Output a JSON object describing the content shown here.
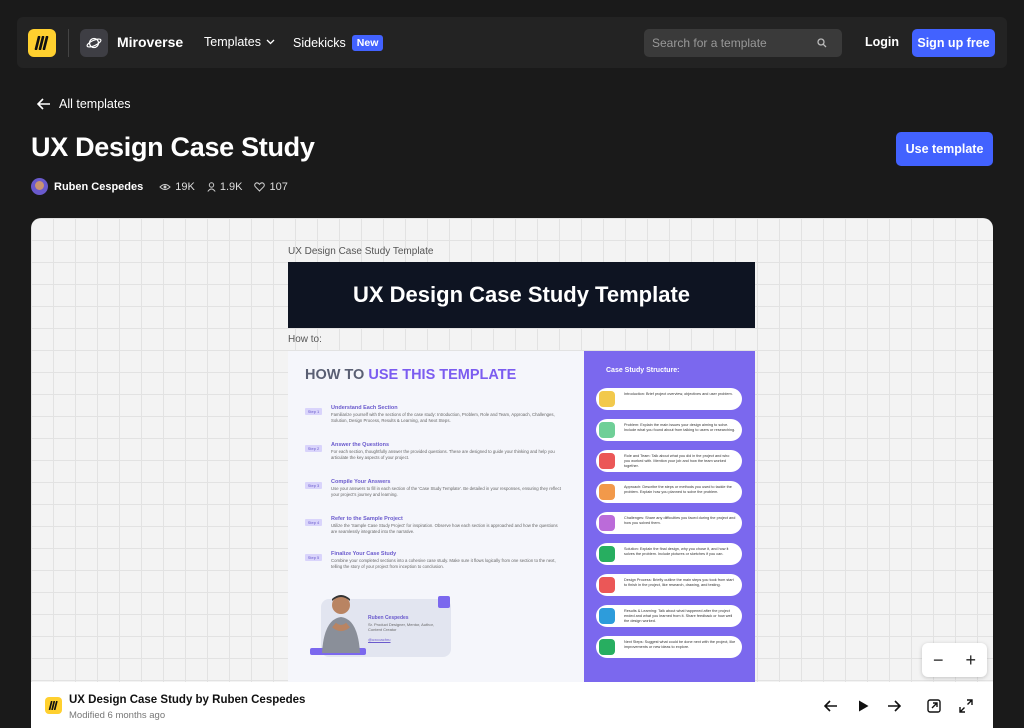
{
  "nav": {
    "brand": "Miroverse",
    "templates_label": "Templates",
    "sidekicks_label": "Sidekicks",
    "new_badge": "New",
    "search_placeholder": "Search for a template",
    "login_label": "Login",
    "signup_label": "Sign up free"
  },
  "header": {
    "back_label": "All templates",
    "title": "UX Design Case Study",
    "use_template_label": "Use template",
    "author": "Ruben Cespedes",
    "views": "19K",
    "users": "1.9K",
    "likes": "107"
  },
  "board": {
    "frame_label": "UX Design Case Study Template",
    "banner_title": "UX Design Case Study Template",
    "howto_label": "How to:",
    "how_title_a": "HOW TO ",
    "how_title_b": "USE THIS TEMPLATE",
    "steps": [
      {
        "tag": "Step 1",
        "heading": "Understand Each Section",
        "text": "Familiarize yourself with the sections of the case study: Introduction, Problem, Role and Team, Approach, Challenges, Solution, Design Process, Results & Learning, and Next Steps."
      },
      {
        "tag": "Step 2",
        "heading": "Answer the Questions",
        "text": "For each section, thoughtfully answer the provided questions. These are designed to guide your thinking and help you articulate the key aspects of your project."
      },
      {
        "tag": "Step 3",
        "heading": "Compile Your Answers",
        "text": "Use your answers to fill in each section of the 'Case Study Template'. Be detailed in your responses, ensuring they reflect your project's journey and learning."
      },
      {
        "tag": "Step 4",
        "heading": "Refer to the Sample Project",
        "text": "Utilize the 'Sample Case Study Project' for inspiration. Observe how each section is approached and how the questions are seamlessly integrated into the narrative."
      },
      {
        "tag": "Step 5",
        "heading": "Finalize Your Case Study",
        "text": "Combine your completed sections into a cohesive case study. Make sure it flows logically from one section to the next, telling the story of your project from inception to conclusion."
      }
    ],
    "person_name": "Ruben Cespedes",
    "person_role": "Sr. Product Designer, Mentor, Author, Content Creator",
    "person_link": "@uxcoachru",
    "structure_title": "Case Study Structure:",
    "structure_items": [
      {
        "text": "Introduction: Brief project overview, objectives and user problem.",
        "color": "#f2c94c"
      },
      {
        "text": "Problem: Explain the main issues your design aiming to solve. Include what you found about from talking to users or researching.",
        "color": "#6fcf97"
      },
      {
        "text": "Role and Team: Talk about what you did in the project and who you worked with. Mention your job and how the team worked together.",
        "color": "#eb5757"
      },
      {
        "text": "Approach: Describe the steps or methods you used to tackle the problem. Explain how you planned to solve the problem.",
        "color": "#f2994a"
      },
      {
        "text": "Challenges: Share any difficulties you faced during the project and how you solved them.",
        "color": "#bb6bd9"
      },
      {
        "text": "Solution: Explain the final design, why you chose it, and how it solves the problem. Include pictures or sketches if you can.",
        "color": "#27ae60"
      },
      {
        "text": "Design Process: Briefly outline the main steps you took from start to finish in the project, like research, drawing, and testing.",
        "color": "#eb5757"
      },
      {
        "text": "Results & Learning: Talk about what happened after the project ended and what you learned from it. Share feedback or how well the design worked.",
        "color": "#2d9cdb"
      },
      {
        "text": "Next Steps: Suggest what could be done next with the project, like improvements or new ideas to explore.",
        "color": "#27ae60"
      }
    ]
  },
  "zoom": {
    "minus": "−",
    "plus": "+"
  },
  "bottom": {
    "title": "UX Design Case Study by Ruben Cespedes",
    "modified": "Modified 6 months ago"
  }
}
